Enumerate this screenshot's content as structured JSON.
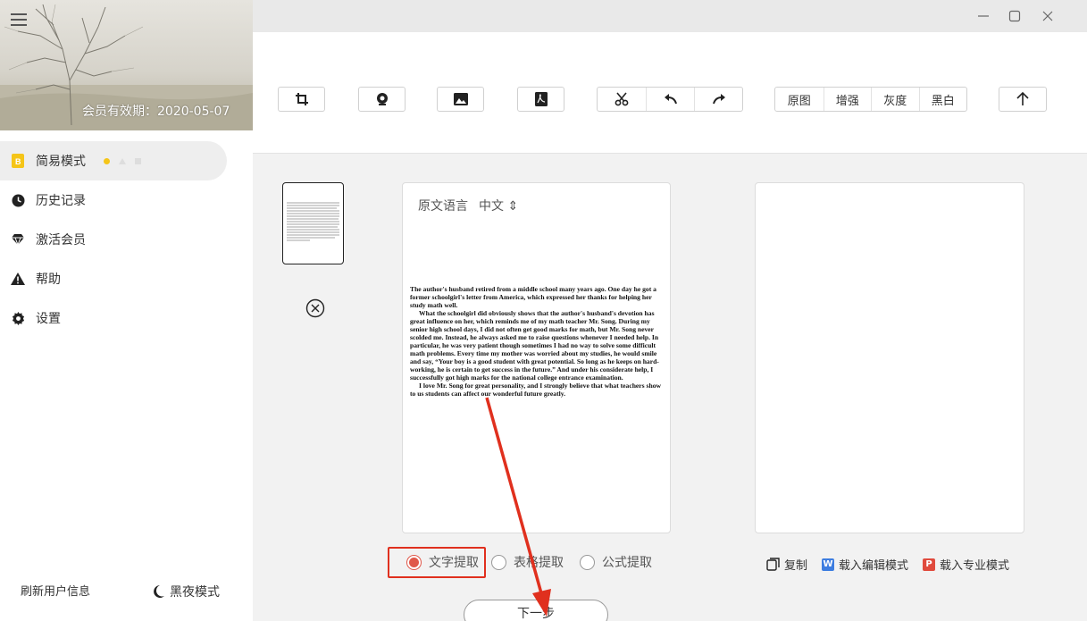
{
  "sidebar": {
    "member_expiry": "会员有效期：2020-05-07",
    "items": [
      {
        "label": "简易模式"
      },
      {
        "label": "历史记录"
      },
      {
        "label": "激活会员"
      },
      {
        "label": "帮助"
      },
      {
        "label": "设置"
      }
    ],
    "refresh_user": "刷新用户信息",
    "night_mode": "黑夜模式"
  },
  "toolbar": {
    "view_modes": [
      "原图",
      "增强",
      "灰度",
      "黑白"
    ]
  },
  "source_panel": {
    "language_label": "原文语言",
    "language_value": "中文 ⇕",
    "document_paragraphs": [
      "The author's husband retired from a middle school many years ago. One day he got a former schoolgirl's letter from America, which expressed her thanks for helping her study math well.",
      "What the schoolgirl did obviously shows that the author's husband's devotion has great influence on her, which reminds me of my math teacher Mr. Song. During my senior high school days, I did not often get good marks for math, but Mr. Song never scolded me. Instead, he always asked me to raise questions whenever I needed help. In particular, he was very patient though sometimes I had no way to solve some difficult math problems. Every time my mother was worried about my studies, he would smile and say, “Your boy is a good student with great potential. So long as he keeps on hard-working, he is certain to get success in the future.” And under his considerate help, I successfully got high marks for the national college entrance examination.",
      "I love Mr. Song for great personality, and I strongly believe that what teachers show to us students can affect our wonderful future greatly."
    ]
  },
  "extraction_modes": {
    "text": "文字提取",
    "table": "表格提取",
    "formula": "公式提取",
    "selected": "text"
  },
  "actions": {
    "copy": "复制",
    "load_edit": "载入编辑模式",
    "load_pro": "载入专业模式",
    "word_badge": "W",
    "ppt_badge": "P"
  },
  "next_button": "下一步",
  "colors": {
    "accent": "#e0584a",
    "annotation": "#e0301e",
    "active_dot": "#f5c518",
    "word": "#3d7de0",
    "ppt": "#e04a3d"
  }
}
